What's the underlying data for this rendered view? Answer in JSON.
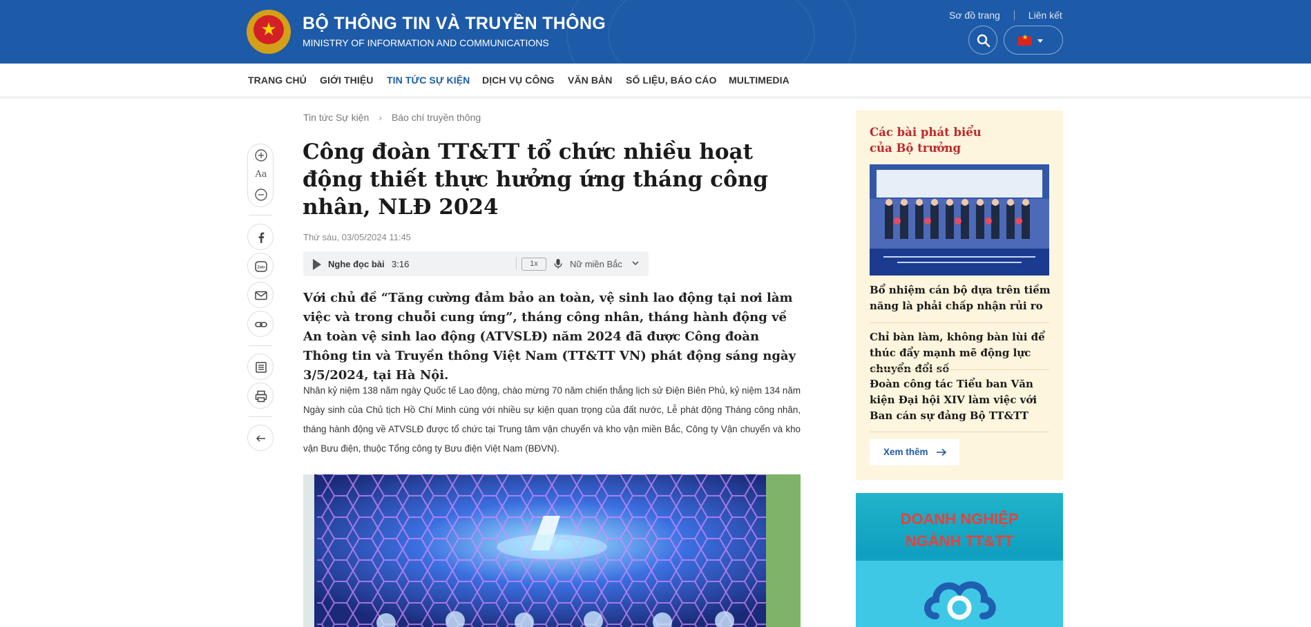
{
  "header": {
    "title": "BỘ THÔNG TIN VÀ TRUYỀN THÔNG",
    "subtitle": "MINISTRY OF INFORMATION AND COMMUNICATIONS",
    "links": [
      "Sơ đồ trang",
      "Liên kết"
    ],
    "emblem_icon": "national-emblem-icon",
    "search_icon": "search-icon",
    "language_flag": "vietnam-flag-icon"
  },
  "nav": {
    "items": [
      "TRANG CHỦ",
      "GIỚI THIỆU",
      "TIN TỨC SỰ KIỆN",
      "DỊCH VỤ CÔNG",
      "VĂN BẢN",
      "SỐ LIỆU, BÁO CÁO",
      "MULTIMEDIA"
    ],
    "active": "TIN TỨC SỰ KIỆN"
  },
  "breadcrumb": [
    "Tin tức Sự kiện",
    "Báo chí truyền thông"
  ],
  "tools": {
    "font_size_label": "Aa",
    "icons": [
      "zoom-in-icon",
      "zoom-out-icon",
      "facebook-icon",
      "zalo-icon",
      "email-icon",
      "link-icon",
      "list-icon",
      "print-icon",
      "back-arrow-icon"
    ]
  },
  "article": {
    "title": "Công đoàn TT&TT tổ chức nhiều hoạt động thiết thực hưởng ứng tháng công nhân, NLĐ 2024",
    "date": "Thứ sáu, 03/05/2024 11:45",
    "audio": {
      "label": "Nghe đọc bài",
      "duration": "3:16",
      "speed": "1x",
      "voice": "Nữ miền Bắc"
    },
    "lead": "Với chủ đề “Tăng cường đảm bảo an toàn, vệ sinh lao động tại nơi làm việc và trong chuỗi cung ứng”, tháng công nhân, tháng hành động về An toàn vệ sinh lao động (ATVSLĐ) năm 2024 đã được Công đoàn Thông tin và Truyền thông Việt Nam (TT&TT VN) phát động sáng ngày 3/5/2024, tại Hà Nội.",
    "body": "Nhân kỷ niệm 138 năm ngày Quốc tế Lao động, chào mừng 70 năm chiến thắng lịch sử Điện Biên Phủ, kỷ niệm 134 năm Ngày sinh của Chủ tịch Hồ Chí Minh cùng với nhiều sự kiện quan trọng của đất nước, Lễ phát động Tháng công nhân, tháng hành động về ATVSLĐ được tổ chức tại Trung tâm vận chuyển và kho vận miền Bắc, Công ty Vận chuyển và kho vận Bưu điện, thuộc Tổng công ty Bưu điện Việt Nam (BĐVN)."
  },
  "sidebar": {
    "title": "Các bài phát biểu của Bộ trưởng",
    "items": [
      "Bổ nhiệm cán bộ dựa trên tiềm năng là phải chấp nhận rủi ro",
      "Chỉ bàn làm, không bàn lùi để thúc đẩy mạnh mẽ động lực chuyển đổi số",
      "Đoàn công tác Tiểu ban Văn kiện Đại hội XIV làm việc với Ban cán sự đảng Bộ TT&TT"
    ],
    "more": "Xem thêm"
  },
  "ad": {
    "title_line1": "DOANH NGHIỆP",
    "title_line2": "NGÀNH TT&TT"
  },
  "colors": {
    "header_blue": "#1d5aa8",
    "sidebar_bg": "#fdf5dd",
    "sidebar_title_red": "#c0272d",
    "ad_bg": "#20b4c9"
  }
}
